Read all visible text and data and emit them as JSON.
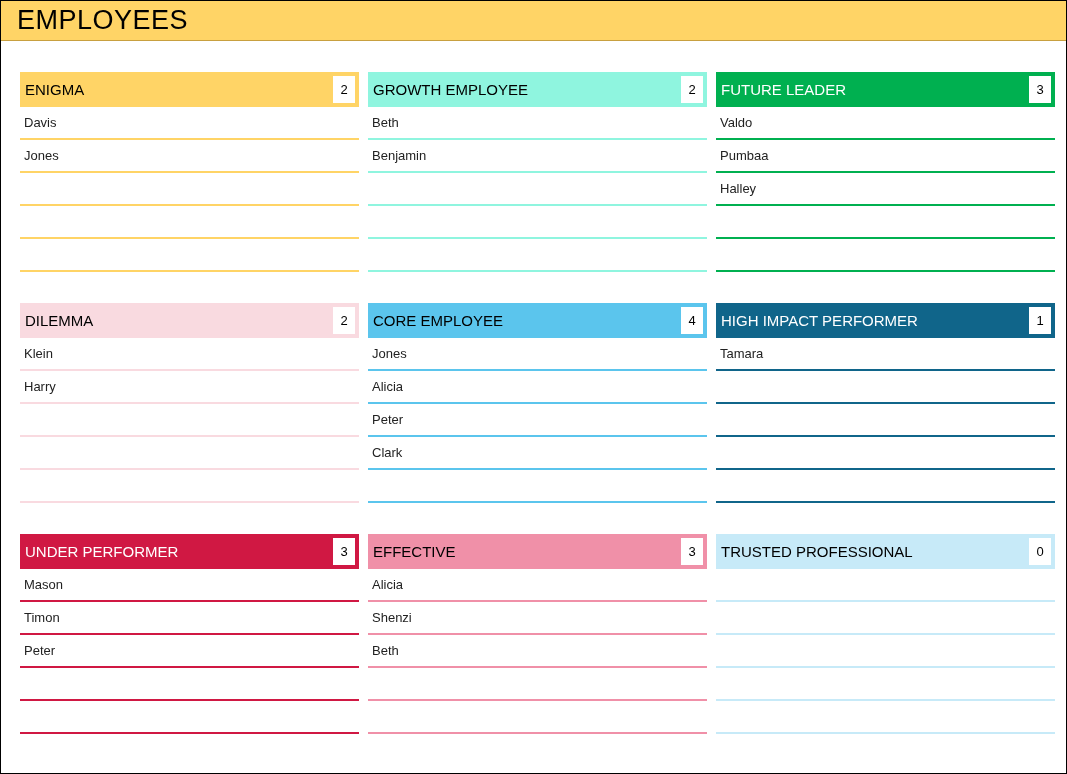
{
  "title": "EMPLOYEES",
  "categories": [
    {
      "name": "ENIGMA",
      "count": "2",
      "color": "#ffd466",
      "employees": [
        "Davis",
        "Jones"
      ]
    },
    {
      "name": "GROWTH EMPLOYEE",
      "count": "2",
      "color": "#8ff5df",
      "employees": [
        "Beth",
        "Benjamin"
      ]
    },
    {
      "name": "FUTURE LEADER",
      "count": "3",
      "color": "#00b050",
      "employees": [
        "Valdo",
        "Pumbaa",
        "Halley"
      ]
    },
    {
      "name": "DILEMMA",
      "count": "2",
      "color": "#f9dae0",
      "employees": [
        "Klein",
        "Harry"
      ]
    },
    {
      "name": "CORE EMPLOYEE",
      "count": "4",
      "color": "#5bc5ed",
      "employees": [
        "Jones",
        "Alicia",
        "Peter",
        "Clark"
      ]
    },
    {
      "name": "HIGH IMPACT PERFORMER",
      "count": "1",
      "color": "#10658a",
      "employees": [
        "Tamara"
      ]
    },
    {
      "name": "UNDER PERFORMER",
      "count": "3",
      "color": "#d01843",
      "employees": [
        "Mason",
        "Timon",
        "Peter"
      ]
    },
    {
      "name": "EFFECTIVE",
      "count": "3",
      "color": "#f090a8",
      "employees": [
        "Alicia",
        "Shenzi",
        "Beth"
      ]
    },
    {
      "name": "TRUSTED PROFESSIONAL",
      "count": "0",
      "color": "#c7eaf8"
    }
  ]
}
